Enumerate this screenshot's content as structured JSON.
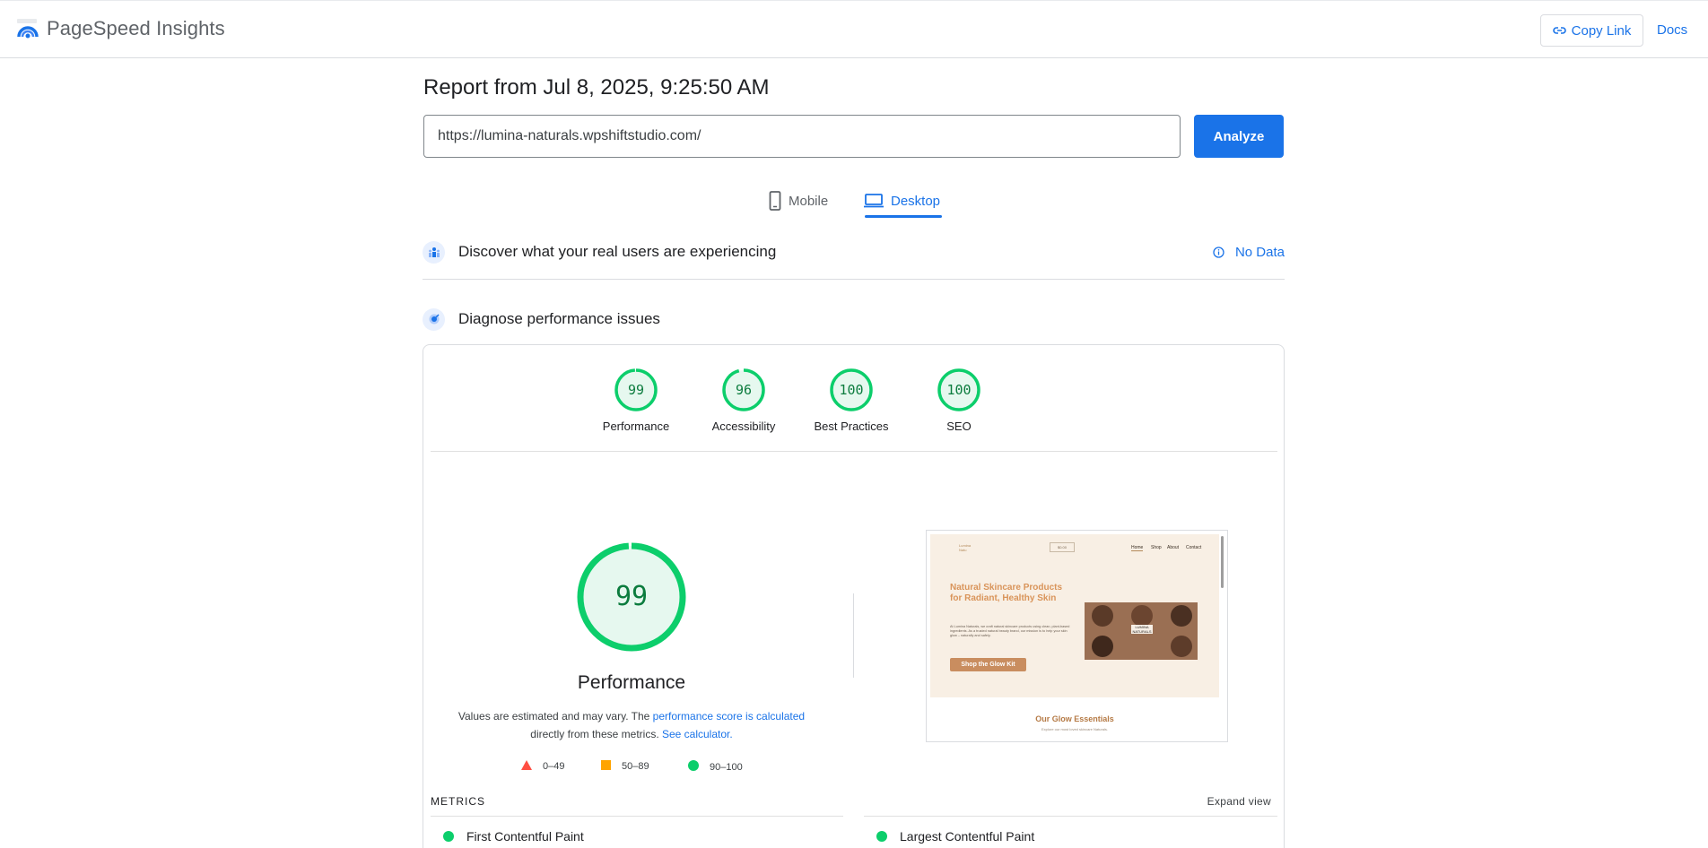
{
  "app": {
    "title": "PageSpeed Insights"
  },
  "header": {
    "copy_link": "Copy Link",
    "docs": "Docs"
  },
  "report": {
    "title": "Report from Jul 8, 2025, 9:25:50 AM",
    "url_value": "https://lumina-naturals.wpshiftstudio.com/",
    "analyze_label": "Analyze"
  },
  "tabs": {
    "mobile": "Mobile",
    "desktop": "Desktop",
    "selected": "Desktop"
  },
  "sections": {
    "discover": "Discover what your real users are experiencing",
    "no_data": "No Data",
    "diagnose": "Diagnose performance issues"
  },
  "scores": [
    {
      "label": "Performance",
      "value": "99",
      "fraction": 0.99
    },
    {
      "label": "Accessibility",
      "value": "96",
      "fraction": 0.96
    },
    {
      "label": "Best Practices",
      "value": "100",
      "fraction": 1.0
    },
    {
      "label": "SEO",
      "value": "100",
      "fraction": 1.0
    }
  ],
  "performance": {
    "score": "99",
    "title": "Performance",
    "note_1": "Values are estimated and may vary. The ",
    "note_link_1": "performance score is calculated",
    "note_2": "directly from these metrics. ",
    "note_link_2": "See calculator."
  },
  "legend": {
    "fail": "0–49",
    "average": "50–89",
    "pass": "90–100"
  },
  "colors": {
    "pass": "#0cce6b",
    "average": "#ffa400",
    "fail": "#ff4e42",
    "accent": "#1a73e8"
  },
  "screenshot": {
    "nav_logo": "Lumina Natu",
    "search": "$0.00",
    "menu": [
      "Home",
      "Shop",
      "About",
      "Contact"
    ],
    "heading": "Natural Skincare Products for Radiant, Healthy Skin",
    "text": "At Lumina Naturals, we craft natural skincare products using clean, plant-based ingredients. As a trusted natural beauty brand, our mission is to help your skin glow – naturally and safely.",
    "cta": "Shop the Glow Kit",
    "lumina": "LUMINA NATURALS",
    "section_title": "Our Glow Essentials",
    "section_sub": "Explore our most loved skincare Naturals."
  },
  "metrics": {
    "label": "METRICS",
    "expand": "Expand view",
    "items": [
      {
        "name": "First Contentful Paint",
        "status": "pass"
      },
      {
        "name": "Largest Contentful Paint",
        "status": "pass"
      }
    ]
  }
}
